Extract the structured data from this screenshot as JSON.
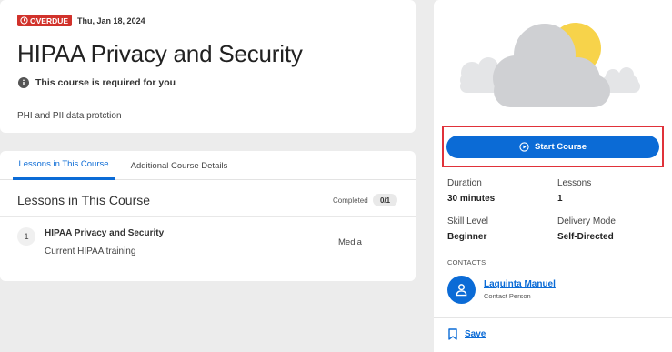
{
  "header": {
    "status_badge": "OVERDUE",
    "due_date": "Thu, Jan 18, 2024",
    "title": "HIPAA Privacy and Security",
    "required_text": "This course is required for you",
    "description": "PHI and PII data protction"
  },
  "tabs": [
    {
      "label": "Lessons in This Course",
      "active": true
    },
    {
      "label": "Additional Course Details",
      "active": false
    }
  ],
  "lessons_section": {
    "title": "Lessons in This Course",
    "completed_label": "Completed",
    "completed_count": "0/1",
    "lessons": [
      {
        "number": "1",
        "title": "HIPAA Privacy and Security",
        "subtitle": "Current HIPAA training",
        "type": "Media"
      }
    ]
  },
  "side_panel": {
    "start_button": "Start Course",
    "duration_label": "Duration",
    "duration_value": "30 minutes",
    "lessons_label": "Lessons",
    "lessons_value": "1",
    "skill_label": "Skill Level",
    "skill_value": "Beginner",
    "delivery_label": "Delivery Mode",
    "delivery_value": "Self-Directed",
    "contacts_heading": "CONTACTS",
    "contact_name": "Laquinta Manuel",
    "contact_role": "Contact Person",
    "save_label": "Save"
  },
  "icons": {
    "overdue": "clock-alert-icon",
    "info": "info-icon",
    "play": "play-circle-icon",
    "avatar": "person-icon",
    "save": "bookmark-icon"
  },
  "colors": {
    "accent": "#0b6bd6",
    "overdue": "#d1322b",
    "highlight_outline": "#e0323a",
    "sun": "#f7d34a",
    "cloud": "#cfd0d3"
  }
}
